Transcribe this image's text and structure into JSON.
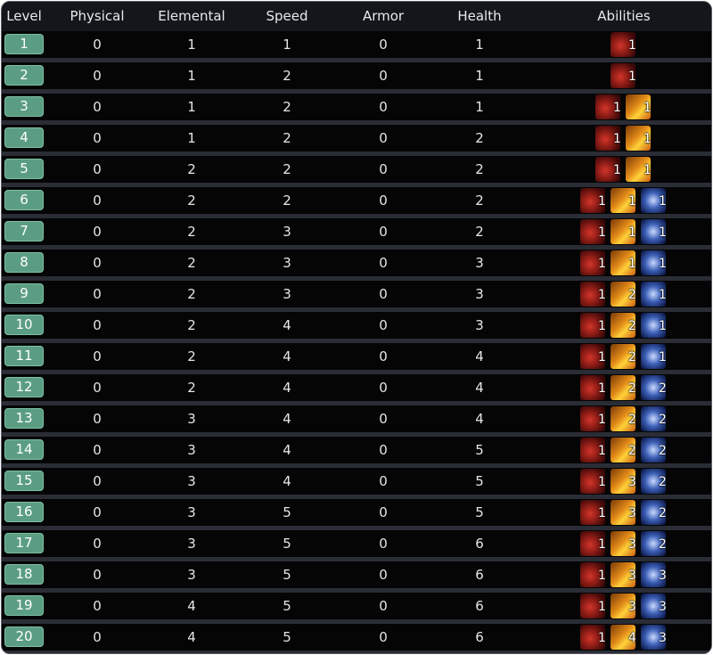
{
  "columns": [
    "Level",
    "Physical",
    "Elemental",
    "Speed",
    "Armor",
    "Health",
    "Abilities"
  ],
  "ability_icons": [
    "claw-ability-icon",
    "flame-ability-icon",
    "wind-ability-icon"
  ],
  "colors": {
    "level_badge": "#5a9d83",
    "background": "#0a0a0c",
    "separator": "#2a2d35"
  },
  "rows": [
    {
      "level": "1",
      "physical": "0",
      "elemental": "1",
      "speed": "1",
      "armor": "0",
      "health": "1",
      "abilities": [
        "1"
      ]
    },
    {
      "level": "2",
      "physical": "0",
      "elemental": "1",
      "speed": "2",
      "armor": "0",
      "health": "1",
      "abilities": [
        "1"
      ]
    },
    {
      "level": "3",
      "physical": "0",
      "elemental": "1",
      "speed": "2",
      "armor": "0",
      "health": "1",
      "abilities": [
        "1",
        "1"
      ]
    },
    {
      "level": "4",
      "physical": "0",
      "elemental": "1",
      "speed": "2",
      "armor": "0",
      "health": "2",
      "abilities": [
        "1",
        "1"
      ]
    },
    {
      "level": "5",
      "physical": "0",
      "elemental": "2",
      "speed": "2",
      "armor": "0",
      "health": "2",
      "abilities": [
        "1",
        "1"
      ]
    },
    {
      "level": "6",
      "physical": "0",
      "elemental": "2",
      "speed": "2",
      "armor": "0",
      "health": "2",
      "abilities": [
        "1",
        "1",
        "1"
      ]
    },
    {
      "level": "7",
      "physical": "0",
      "elemental": "2",
      "speed": "3",
      "armor": "0",
      "health": "2",
      "abilities": [
        "1",
        "1",
        "1"
      ]
    },
    {
      "level": "8",
      "physical": "0",
      "elemental": "2",
      "speed": "3",
      "armor": "0",
      "health": "3",
      "abilities": [
        "1",
        "1",
        "1"
      ]
    },
    {
      "level": "9",
      "physical": "0",
      "elemental": "2",
      "speed": "3",
      "armor": "0",
      "health": "3",
      "abilities": [
        "1",
        "2",
        "1"
      ]
    },
    {
      "level": "10",
      "physical": "0",
      "elemental": "2",
      "speed": "4",
      "armor": "0",
      "health": "3",
      "abilities": [
        "1",
        "2",
        "1"
      ]
    },
    {
      "level": "11",
      "physical": "0",
      "elemental": "2",
      "speed": "4",
      "armor": "0",
      "health": "4",
      "abilities": [
        "1",
        "2",
        "1"
      ]
    },
    {
      "level": "12",
      "physical": "0",
      "elemental": "2",
      "speed": "4",
      "armor": "0",
      "health": "4",
      "abilities": [
        "1",
        "2",
        "2"
      ]
    },
    {
      "level": "13",
      "physical": "0",
      "elemental": "3",
      "speed": "4",
      "armor": "0",
      "health": "4",
      "abilities": [
        "1",
        "2",
        "2"
      ]
    },
    {
      "level": "14",
      "physical": "0",
      "elemental": "3",
      "speed": "4",
      "armor": "0",
      "health": "5",
      "abilities": [
        "1",
        "2",
        "2"
      ]
    },
    {
      "level": "15",
      "physical": "0",
      "elemental": "3",
      "speed": "4",
      "armor": "0",
      "health": "5",
      "abilities": [
        "1",
        "3",
        "2"
      ]
    },
    {
      "level": "16",
      "physical": "0",
      "elemental": "3",
      "speed": "5",
      "armor": "0",
      "health": "5",
      "abilities": [
        "1",
        "3",
        "2"
      ]
    },
    {
      "level": "17",
      "physical": "0",
      "elemental": "3",
      "speed": "5",
      "armor": "0",
      "health": "6",
      "abilities": [
        "1",
        "3",
        "2"
      ]
    },
    {
      "level": "18",
      "physical": "0",
      "elemental": "3",
      "speed": "5",
      "armor": "0",
      "health": "6",
      "abilities": [
        "1",
        "3",
        "3"
      ]
    },
    {
      "level": "19",
      "physical": "0",
      "elemental": "4",
      "speed": "5",
      "armor": "0",
      "health": "6",
      "abilities": [
        "1",
        "3",
        "3"
      ]
    },
    {
      "level": "20",
      "physical": "0",
      "elemental": "4",
      "speed": "5",
      "armor": "0",
      "health": "6",
      "abilities": [
        "1",
        "4",
        "3"
      ]
    }
  ]
}
